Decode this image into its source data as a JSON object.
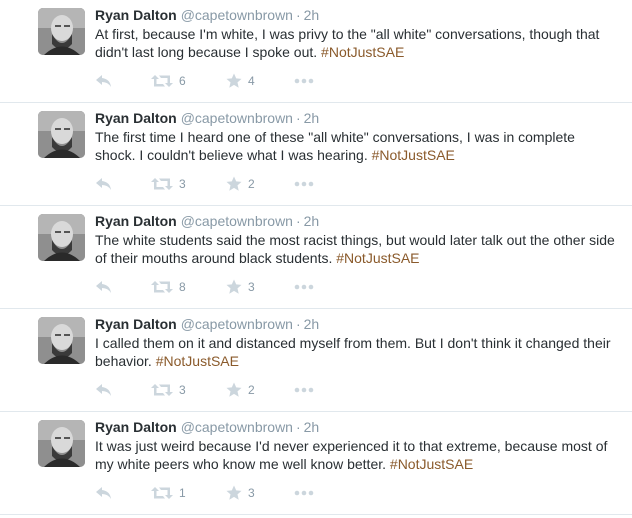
{
  "colors": {
    "text": "#292f33",
    "meta": "#8899a6",
    "hashtag": "#8a5a2b",
    "icon": "#ccd6dd",
    "divider": "#e1e8ed"
  },
  "icons": [
    "reply-icon",
    "retweet-icon",
    "favorite-star-icon",
    "more-dots-icon"
  ],
  "tweets": [
    {
      "name": "Ryan Dalton",
      "handle": "@capetownbrown",
      "dot": "·",
      "time": "2h",
      "text": "At first, because I'm white, I was privy to the \"all white\" conversations, though that didn't last long because I spoke out. ",
      "hashtag": "#NotJustSAE",
      "retweets": "6",
      "favorites": "4"
    },
    {
      "name": "Ryan Dalton",
      "handle": "@capetownbrown",
      "dot": "·",
      "time": "2h",
      "text": "The first time I heard one of these \"all white\" conversations, I was in complete shock. I couldn't believe what I was hearing. ",
      "hashtag": "#NotJustSAE",
      "retweets": "3",
      "favorites": "2"
    },
    {
      "name": "Ryan Dalton",
      "handle": "@capetownbrown",
      "dot": "·",
      "time": "2h",
      "text": "The white students said the most racist things, but would later talk out the other side of their mouths around black students. ",
      "hashtag": "#NotJustSAE",
      "retweets": "8",
      "favorites": "3"
    },
    {
      "name": "Ryan Dalton",
      "handle": "@capetownbrown",
      "dot": "·",
      "time": "2h",
      "text": "I called them on it and distanced myself from them. But I don't think it changed their behavior. ",
      "hashtag": "#NotJustSAE",
      "retweets": "3",
      "favorites": "2"
    },
    {
      "name": "Ryan Dalton",
      "handle": "@capetownbrown",
      "dot": "·",
      "time": "2h",
      "text": "It was just weird because I'd never experienced it to that extreme, because most of my white peers who know me well know better. ",
      "hashtag": "#NotJustSAE",
      "retweets": "1",
      "favorites": "3"
    }
  ]
}
